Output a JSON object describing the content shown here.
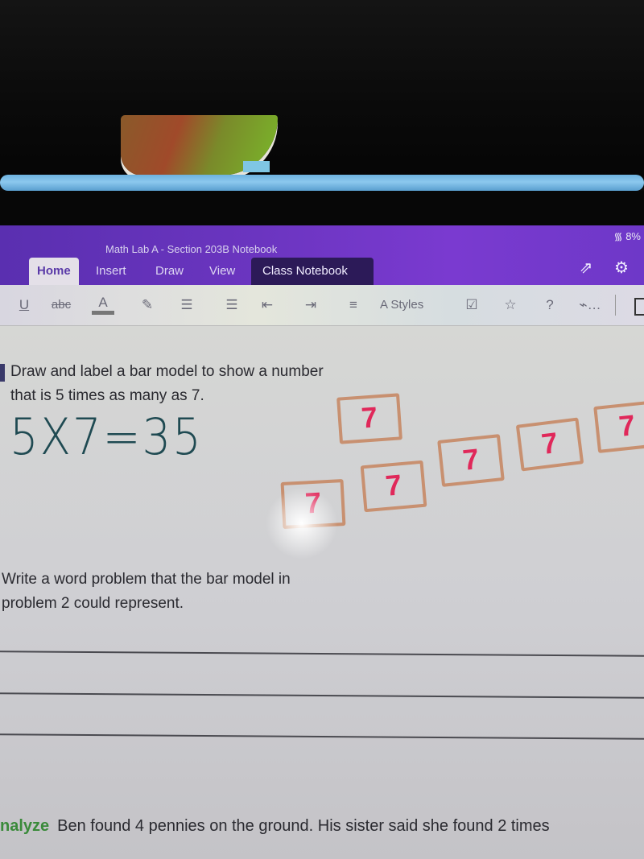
{
  "device": {
    "status_bar": {
      "wifi_icon": "wifi-icon",
      "battery": "8%"
    }
  },
  "app": {
    "notebook_title": "Math Lab A - Section 203B Notebook",
    "tabs": [
      {
        "label": "Home",
        "active": true
      },
      {
        "label": "Insert",
        "active": false
      },
      {
        "label": "Draw",
        "active": false
      },
      {
        "label": "View",
        "active": false
      },
      {
        "label": "Class Notebook",
        "active": false
      }
    ],
    "right_icons": [
      "share-icon",
      "settings-gear-icon"
    ],
    "toolbar": [
      {
        "name": "underline",
        "glyph": "U"
      },
      {
        "name": "strikethrough",
        "glyph": "abc"
      },
      {
        "name": "font-color",
        "glyph": "A"
      },
      {
        "name": "highlighter",
        "glyph": "✎"
      },
      {
        "name": "bullet-list",
        "glyph": "☰"
      },
      {
        "name": "numbered-list",
        "glyph": "☰"
      },
      {
        "name": "decrease-indent",
        "glyph": "⇤"
      },
      {
        "name": "increase-indent",
        "glyph": "⇥"
      },
      {
        "name": "align",
        "glyph": "≡"
      },
      {
        "name": "styles",
        "glyph": "A",
        "label": "Styles"
      },
      {
        "name": "todo-checkbox",
        "glyph": "☑"
      },
      {
        "name": "important-star",
        "glyph": "☆"
      },
      {
        "name": "question-tag",
        "glyph": "?"
      },
      {
        "name": "more-tags",
        "glyph": "⌁…"
      }
    ]
  },
  "page": {
    "question2": {
      "line1": "Draw and label a bar model to show a number",
      "line2": "that is 5 times as many as 7."
    },
    "handwritten_equation": "5X7=35",
    "bar_model_boxes": [
      "7",
      "7",
      "7",
      "7",
      "7",
      "7"
    ],
    "question3": {
      "line1": "Write a word problem that the bar model in",
      "line2": "problem 2 could represent."
    },
    "analyze": {
      "label": "nalyze",
      "text": "Ben found 4 pennies on the ground. His sister said she found 2 times"
    }
  }
}
